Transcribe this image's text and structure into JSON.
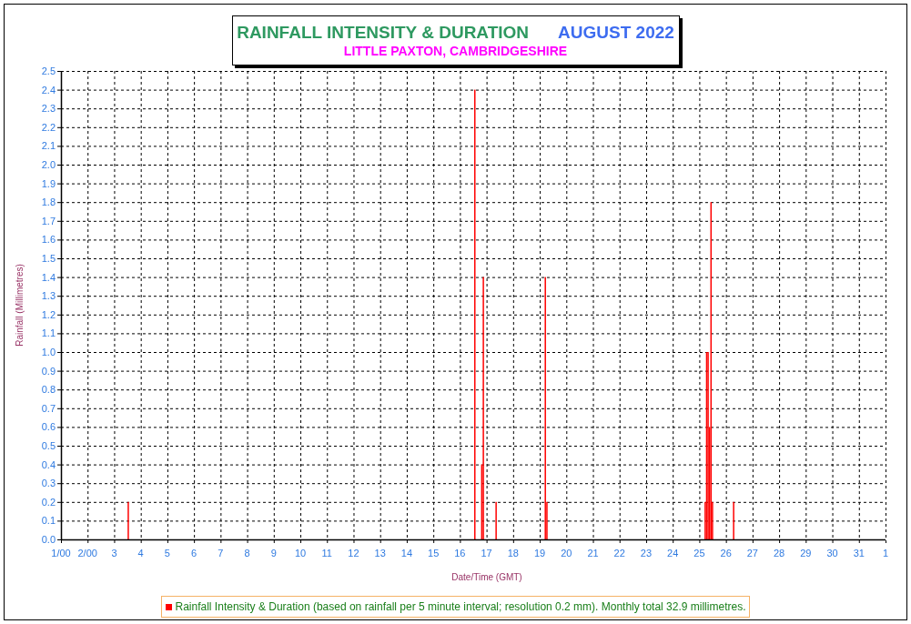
{
  "header": {
    "title": "RAINFALL INTENSITY & DURATION",
    "period": "AUGUST 2022",
    "location": "LITTLE PAXTON, CAMBRIDGESHIRE"
  },
  "chart": {
    "next_month_label": "1",
    "chart_data": {
      "type": "bar",
      "xlabel": "Date/Time (GMT)",
      "ylabel": "Rainfall (Millimetres)",
      "xlim": [
        1,
        32
      ],
      "ylim": [
        0,
        2.5
      ],
      "grid": true,
      "x": [
        3.53,
        16.56,
        16.82,
        16.88,
        17.36,
        19.21,
        19.27,
        25.22,
        25.275,
        25.33,
        25.385,
        25.44,
        25.495,
        26.29
      ],
      "series": [
        {
          "name": "Rainfall Intensity & Duration (based on rainfall per 5 minute interval; resolution 0.2 mm). Monthly total 32.9 millimetres.",
          "color": "#ff0000",
          "values": [
            0.2,
            2.4,
            0.4,
            1.4,
            0.2,
            1.4,
            0.2,
            0.2,
            1.0,
            1.0,
            0.6,
            1.8,
            0.2,
            0.2
          ]
        }
      ],
      "xticks": [
        {
          "value": 1,
          "label": "1/00"
        },
        {
          "value": 2,
          "label": "2/00"
        },
        {
          "value": 3,
          "label": "3"
        },
        {
          "value": 4,
          "label": "4"
        },
        {
          "value": 5,
          "label": "5"
        },
        {
          "value": 6,
          "label": "6"
        },
        {
          "value": 7,
          "label": "7"
        },
        {
          "value": 8,
          "label": "8"
        },
        {
          "value": 9,
          "label": "9"
        },
        {
          "value": 10,
          "label": "10"
        },
        {
          "value": 11,
          "label": "11"
        },
        {
          "value": 12,
          "label": "12"
        },
        {
          "value": 13,
          "label": "13"
        },
        {
          "value": 14,
          "label": "14"
        },
        {
          "value": 15,
          "label": "15"
        },
        {
          "value": 16,
          "label": "16"
        },
        {
          "value": 17,
          "label": "17"
        },
        {
          "value": 18,
          "label": "18"
        },
        {
          "value": 19,
          "label": "19"
        },
        {
          "value": 20,
          "label": "20"
        },
        {
          "value": 21,
          "label": "21"
        },
        {
          "value": 22,
          "label": "22"
        },
        {
          "value": 23,
          "label": "23"
        },
        {
          "value": 24,
          "label": "24"
        },
        {
          "value": 25,
          "label": "25"
        },
        {
          "value": 26,
          "label": "26"
        },
        {
          "value": 27,
          "label": "27"
        },
        {
          "value": 28,
          "label": "28"
        },
        {
          "value": 29,
          "label": "29"
        },
        {
          "value": 30,
          "label": "30"
        },
        {
          "value": 31,
          "label": "31"
        }
      ],
      "yticks": [
        {
          "value": 0,
          "label": "0.0"
        },
        {
          "value": 0.1,
          "label": "0.1"
        },
        {
          "value": 0.2,
          "label": "0.2"
        },
        {
          "value": 0.3,
          "label": "0.3"
        },
        {
          "value": 0.4,
          "label": "0.4"
        },
        {
          "value": 0.5,
          "label": "0.5"
        },
        {
          "value": 0.6,
          "label": "0.6"
        },
        {
          "value": 0.7,
          "label": "0.7"
        },
        {
          "value": 0.8,
          "label": "0.8"
        },
        {
          "value": 0.9,
          "label": "0.9"
        },
        {
          "value": 1.0,
          "label": "1.0"
        },
        {
          "value": 1.1,
          "label": "1.1"
        },
        {
          "value": 1.2,
          "label": "1.2"
        },
        {
          "value": 1.3,
          "label": "1.3"
        },
        {
          "value": 1.4,
          "label": "1.4"
        },
        {
          "value": 1.5,
          "label": "1.5"
        },
        {
          "value": 1.6,
          "label": "1.6"
        },
        {
          "value": 1.7,
          "label": "1.7"
        },
        {
          "value": 1.8,
          "label": "1.8"
        },
        {
          "value": 1.9,
          "label": "1.9"
        },
        {
          "value": 2.0,
          "label": "2.0"
        },
        {
          "value": 2.1,
          "label": "2.1"
        },
        {
          "value": 2.2,
          "label": "2.2"
        },
        {
          "value": 2.3,
          "label": "2.3"
        },
        {
          "value": 2.4,
          "label": "2.4"
        },
        {
          "value": 2.5,
          "label": "2.5"
        }
      ]
    }
  }
}
